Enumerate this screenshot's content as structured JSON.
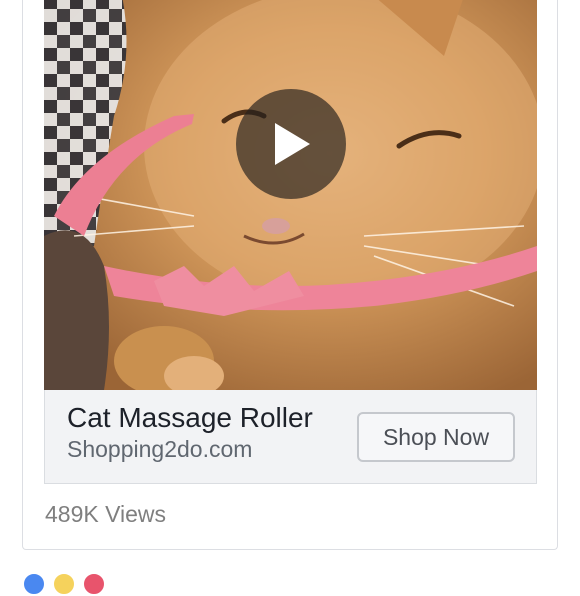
{
  "ad": {
    "title": "Cat Massage Roller",
    "domain": "Shopping2do.com",
    "cta_label": "Shop Now"
  },
  "stats": {
    "views": "489K Views"
  },
  "video": {
    "state": "paused",
    "play_icon": "play-icon"
  },
  "reactions": [
    {
      "icon": "like-icon",
      "color": "#4a88f0"
    },
    {
      "icon": "haha-icon",
      "color": "#f5d25c"
    },
    {
      "icon": "love-icon",
      "color": "#e8546c"
    }
  ]
}
